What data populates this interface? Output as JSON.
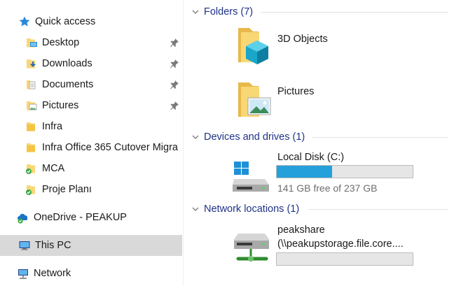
{
  "nav": {
    "quick_access": "Quick access",
    "items": [
      {
        "label": "Desktop",
        "pinned": true
      },
      {
        "label": "Downloads",
        "pinned": true
      },
      {
        "label": "Documents",
        "pinned": true
      },
      {
        "label": "Pictures",
        "pinned": true
      },
      {
        "label": "Infra",
        "pinned": false
      },
      {
        "label": "Infra Office 365 Cutover Migra",
        "pinned": false
      },
      {
        "label": "MCA",
        "pinned": false
      },
      {
        "label": "Proje Planı",
        "pinned": false
      }
    ],
    "onedrive": "OneDrive - PEAKUP",
    "this_pc": "This PC",
    "network": "Network"
  },
  "groups": {
    "folders": "Folders (7)",
    "devices": "Devices and drives (1)",
    "network": "Network locations (1)"
  },
  "folders": [
    {
      "name": "3D Objects"
    },
    {
      "name": "Pictures"
    }
  ],
  "drive": {
    "name": "Local Disk (C:)",
    "free_text": "141 GB free of 237 GB",
    "used_fraction": 0.405
  },
  "network_location": {
    "name": "peakshare",
    "path": "(\\\\peakupstorage.file.core....",
    "used_fraction": 0
  },
  "colors": {
    "accent": "#26a0da",
    "group_header": "#1e3287",
    "selected_bg": "#d9d9d9"
  }
}
